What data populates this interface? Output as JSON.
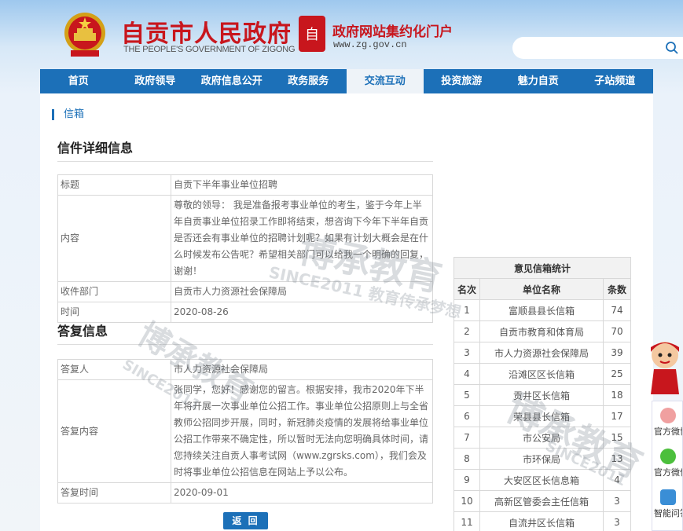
{
  "header": {
    "site_title": "自贡市人民政府",
    "site_subtitle": "THE PEOPLE'S GOVERNMENT OF ZIGONG",
    "seal_char": "自",
    "portal_title": "政府网站集约化门户",
    "portal_url": "www.zg.gov.cn",
    "search": {
      "placeholder": ""
    }
  },
  "nav": {
    "items": [
      {
        "label": "首页"
      },
      {
        "label": "政府领导"
      },
      {
        "label": "政府信息公开"
      },
      {
        "label": "政务服务"
      },
      {
        "label": "交流互动"
      },
      {
        "label": "投资旅游"
      },
      {
        "label": "魅力自贡"
      },
      {
        "label": "子站频道"
      }
    ],
    "active_index": 4
  },
  "breadcrumb": "信箱",
  "letter": {
    "section_title": "信件详细信息",
    "rows": [
      {
        "key": "标题",
        "value": "自贡下半年事业单位招聘"
      },
      {
        "key": "内容",
        "value": "尊敬的领导：  我是准备报考事业单位的考生，鉴于今年上半年自贡事业单位招录工作即将结束，想咨询下今年下半年自贡是否还会有事业单位的招聘计划呢？如果有计划大概会是在什么时候发布公告呢？希望相关部门可以给我一个明确的回复，谢谢！"
      },
      {
        "key": "收件部门",
        "value": "自贡市人力资源社会保障局"
      },
      {
        "key": "时间",
        "value": "2020-08-26"
      }
    ]
  },
  "reply": {
    "section_title": "答复信息",
    "rows": [
      {
        "key": "答复人",
        "value": "市人力资源社会保障局"
      },
      {
        "key": "答复内容",
        "value": "张同学，您好！感谢您的留言。根据安排，我市2020年下半年将开展一次事业单位公招工作。事业单位公招原则上与全省教师公招同步开展，同时，新冠肺炎疫情的发展将给事业单位公招工作带来不确定性，所以暂时无法向您明确具体时间，请您持续关注自贡人事考试网（www.zgrsks.com），我们会及时将事业单位公招信息在网站上予以公布。"
      },
      {
        "key": "答复时间",
        "value": "2020-09-01"
      }
    ]
  },
  "back_button": "返 回",
  "stats": {
    "title": "意见信箱统计",
    "headers": [
      "名次",
      "单位名称",
      "条数"
    ],
    "rows": [
      [
        "1",
        "富顺县县长信箱",
        "74"
      ],
      [
        "2",
        "自贡市教育和体育局",
        "70"
      ],
      [
        "3",
        "市人力资源社会保障局",
        "39"
      ],
      [
        "4",
        "沿滩区区长信箱",
        "25"
      ],
      [
        "5",
        "贡井区长信箱",
        "18"
      ],
      [
        "6",
        "荣县县长信箱",
        "17"
      ],
      [
        "7",
        "市公安局",
        "15"
      ],
      [
        "8",
        "市环保局",
        "13"
      ],
      [
        "9",
        "大安区区长信息箱",
        "4"
      ],
      [
        "10",
        "高新区管委会主任信箱",
        "3"
      ],
      [
        "11",
        "自流井区长信箱",
        "3"
      ]
    ]
  },
  "watermark": {
    "brand": "博承教育",
    "since": "SINCE2011 教育传承梦想",
    "since_short": "SINCE2011"
  },
  "float_panel": {
    "items": [
      {
        "label": "官方微博",
        "icon": "weibo-icon"
      },
      {
        "label": "官方微信",
        "icon": "wechat-icon"
      },
      {
        "label": "智能问答",
        "icon": "robot-icon"
      }
    ]
  },
  "colors": {
    "brand_red": "#c8161d",
    "nav_blue": "#1c70b8"
  }
}
